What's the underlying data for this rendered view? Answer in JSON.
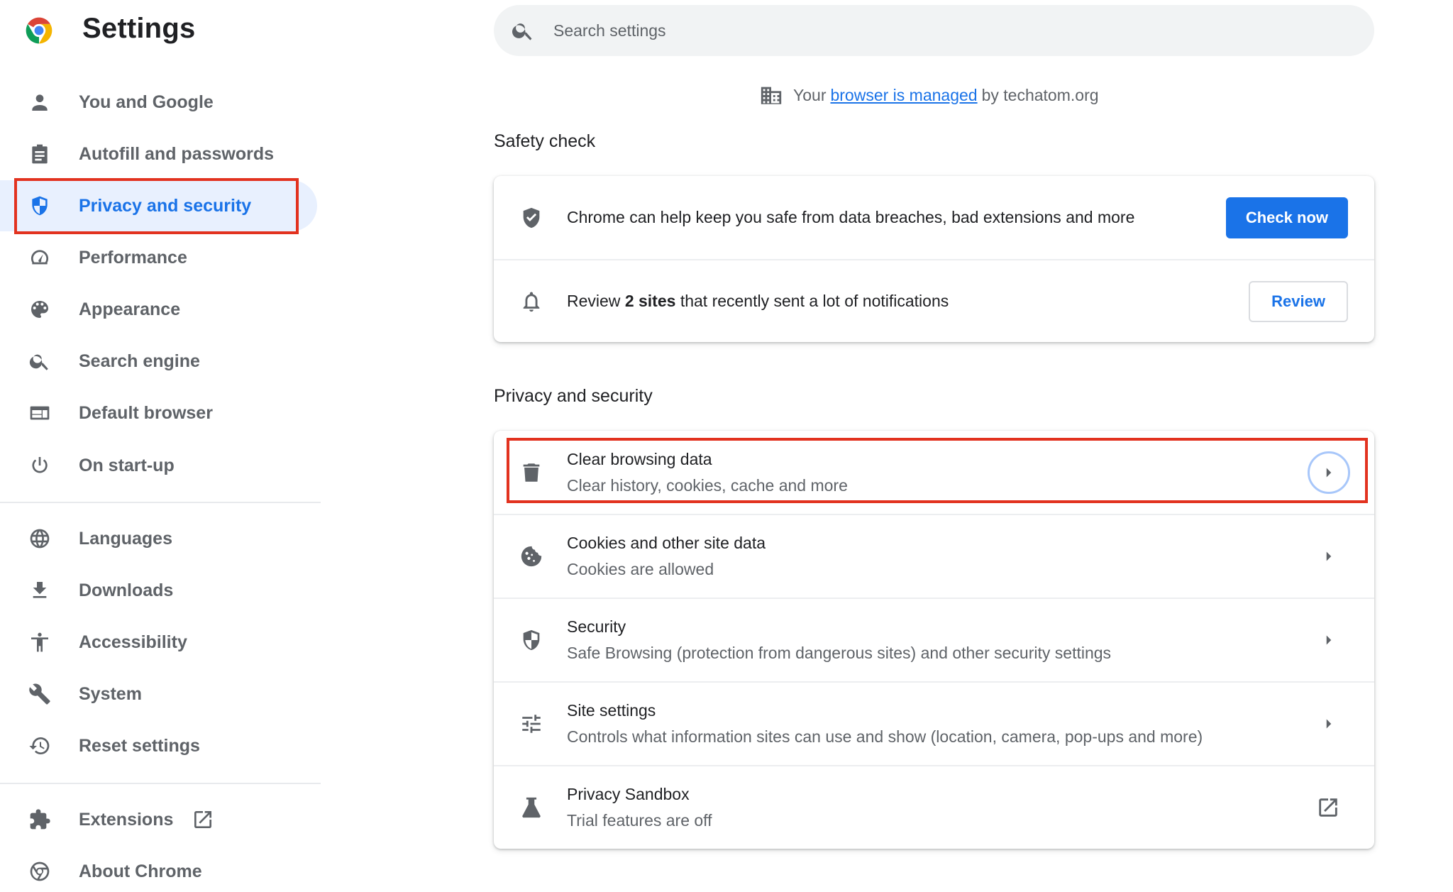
{
  "header": {
    "title": "Settings"
  },
  "search": {
    "placeholder": "Search settings",
    "value": ""
  },
  "managed_notice": {
    "prefix": "Your",
    "link": "browser is managed",
    "suffix": "by techatom.org"
  },
  "sidebar": {
    "items": [
      {
        "label": "You and Google",
        "icon": "person-icon"
      },
      {
        "label": "Autofill and passwords",
        "icon": "clipboard-icon"
      },
      {
        "label": "Privacy and security",
        "icon": "shield-icon",
        "selected": true
      },
      {
        "label": "Performance",
        "icon": "speedometer-icon"
      },
      {
        "label": "Appearance",
        "icon": "palette-icon"
      },
      {
        "label": "Search engine",
        "icon": "search-icon"
      },
      {
        "label": "Default browser",
        "icon": "browser-window-icon"
      },
      {
        "label": "On start-up",
        "icon": "power-icon"
      },
      {
        "label": "Languages",
        "icon": "globe-icon"
      },
      {
        "label": "Downloads",
        "icon": "download-icon"
      },
      {
        "label": "Accessibility",
        "icon": "accessibility-icon"
      },
      {
        "label": "System",
        "icon": "wrench-icon"
      },
      {
        "label": "Reset settings",
        "icon": "history-icon"
      },
      {
        "label": "Extensions",
        "icon": "puzzle-icon"
      },
      {
        "label": "About Chrome",
        "icon": "chrome-icon"
      }
    ]
  },
  "safety_check": {
    "title": "Safety check",
    "rows": [
      {
        "text": "Chrome can help keep you safe from data breaches, bad extensions and more",
        "button": "Check now",
        "icon": "shield-check-icon"
      },
      {
        "text_before": "Review",
        "text_bold": "2 sites",
        "text_after": "that recently sent a lot of notifications",
        "button": "Review",
        "icon": "bell-icon"
      }
    ]
  },
  "privacy": {
    "title": "Privacy and security",
    "rows": [
      {
        "primary": "Clear browsing data",
        "secondary": "Clear history, cookies, cache and more",
        "icon": "trash-icon",
        "action": "arrow"
      },
      {
        "primary": "Cookies and other site data",
        "secondary": "Cookies are allowed",
        "icon": "cookie-icon",
        "action": "arrow"
      },
      {
        "primary": "Security",
        "secondary": "Safe Browsing (protection from dangerous sites) and other security settings",
        "icon": "security-shield-icon",
        "action": "arrow"
      },
      {
        "primary": "Site settings",
        "secondary": "Controls what information sites can use and show (location, camera, pop-ups and more)",
        "icon": "tune-icon",
        "action": "arrow"
      },
      {
        "primary": "Privacy Sandbox",
        "secondary": "Trial features are off",
        "icon": "flask-icon",
        "action": "external"
      }
    ]
  },
  "colors": {
    "accent": "#1a73e8",
    "highlight": "#e2321f",
    "selected_bg": "#e8f0fe"
  }
}
